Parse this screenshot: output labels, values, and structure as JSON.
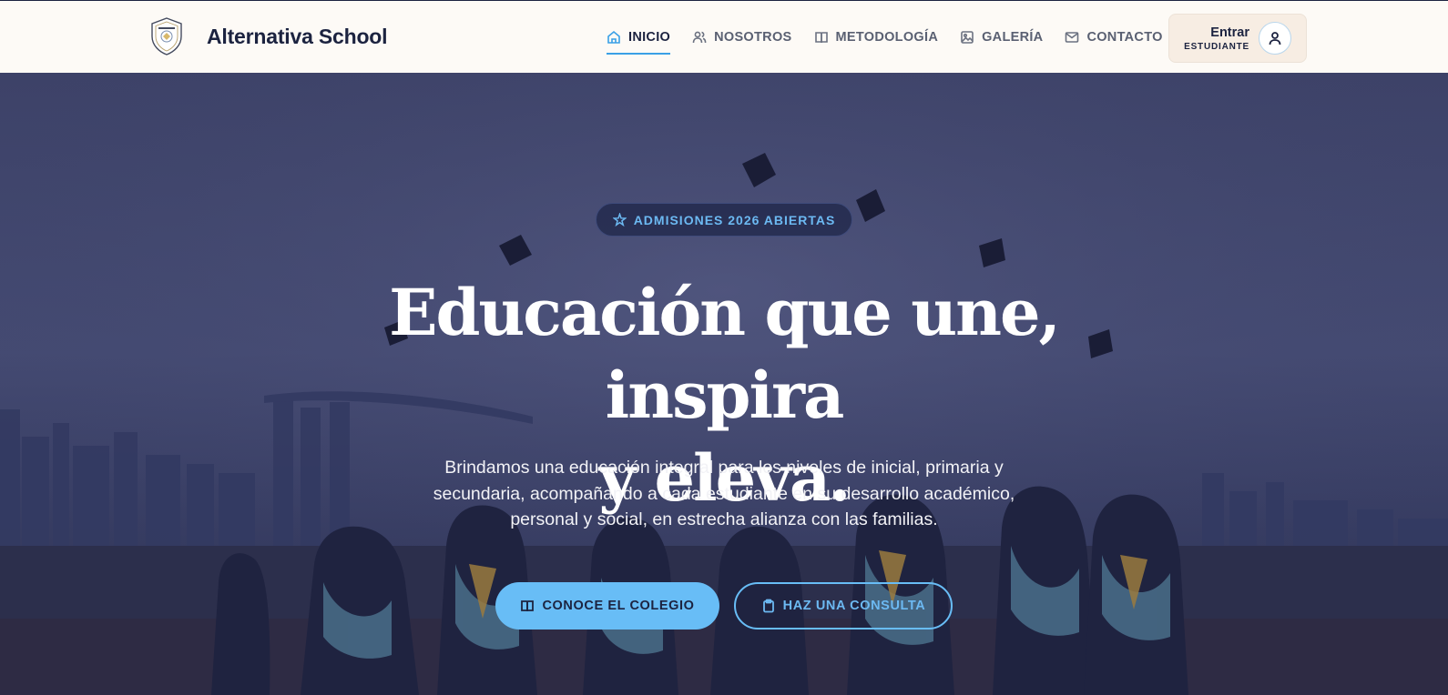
{
  "header": {
    "brand": "Alternativa School",
    "logo_icon": "school-crest-icon",
    "nav": [
      {
        "label": "INICIO",
        "icon": "home-icon",
        "active": true
      },
      {
        "label": "NOSOTROS",
        "icon": "users-icon",
        "active": false
      },
      {
        "label": "METODOLOGÍA",
        "icon": "book-open-icon",
        "active": false
      },
      {
        "label": "GALERÍA",
        "icon": "image-icon",
        "active": false
      },
      {
        "label": "CONTACTO",
        "icon": "mail-icon",
        "active": false
      }
    ],
    "login": {
      "label": "Entrar",
      "sublabel": "ESTUDIANTE",
      "icon": "user-icon"
    }
  },
  "hero": {
    "badge": "ADMISIONES 2026 ABIERTAS",
    "badge_icon": "sparkle-icon",
    "headline_line1": "Educación que une, inspira",
    "headline_line2": "y eleva.",
    "description": "Brindamos una educación integral para los niveles de inicial, primaria y secundaria, acompañando a cada estudiante en su desarrollo académico, personal y social, en estrecha alianza con las familias.",
    "primary_button": "CONOCE EL COLEGIO",
    "primary_button_icon": "book-open-icon",
    "secondary_button": "HAZ UNA CONSULTA",
    "secondary_button_icon": "clipboard-icon",
    "background_description": "graduates-throwing-caps-photo"
  },
  "colors": {
    "navy": "#1c2340",
    "accent": "#68bdf6",
    "header_bg": "#fdfaf6",
    "hero_overlay": "#2e3358"
  }
}
